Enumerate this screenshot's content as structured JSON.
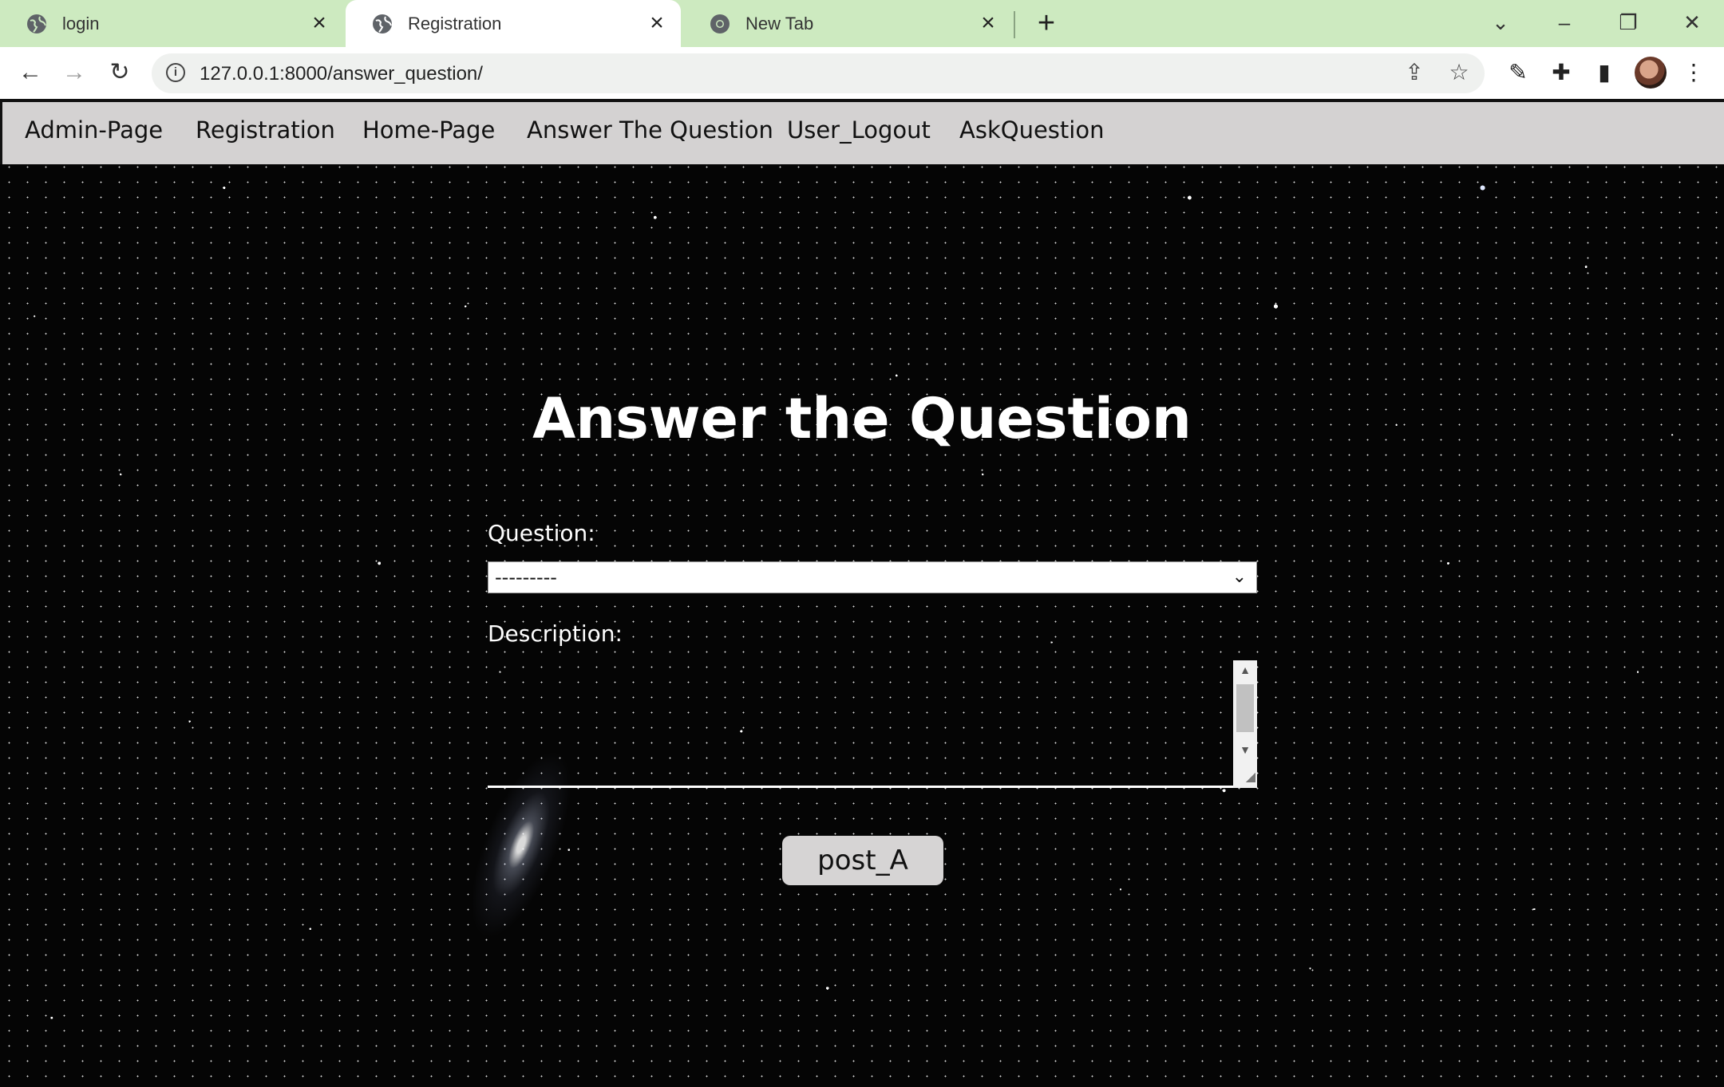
{
  "browser": {
    "tabs": [
      {
        "label": "login",
        "icon": "globe-icon"
      },
      {
        "label": "Registration",
        "icon": "globe-icon"
      },
      {
        "label": "New Tab",
        "icon": "chrome-icon"
      }
    ],
    "active_tab": 1,
    "address": {
      "url": "127.0.0.1:8000/answer_question/"
    },
    "tab_bar_color": "#cdeac0"
  },
  "nav": {
    "items": [
      {
        "label": "Admin-Page"
      },
      {
        "label": "Registration"
      },
      {
        "label": "Home-Page"
      },
      {
        "label": "Answer The Question"
      },
      {
        "label": "User_Logout"
      },
      {
        "label": "AskQuestion"
      }
    ]
  },
  "form": {
    "title": "Answer the Question",
    "question_label": "Question:",
    "question_value": "---------",
    "description_label": "Description:",
    "description_value": "",
    "submit_label": "post_A"
  }
}
